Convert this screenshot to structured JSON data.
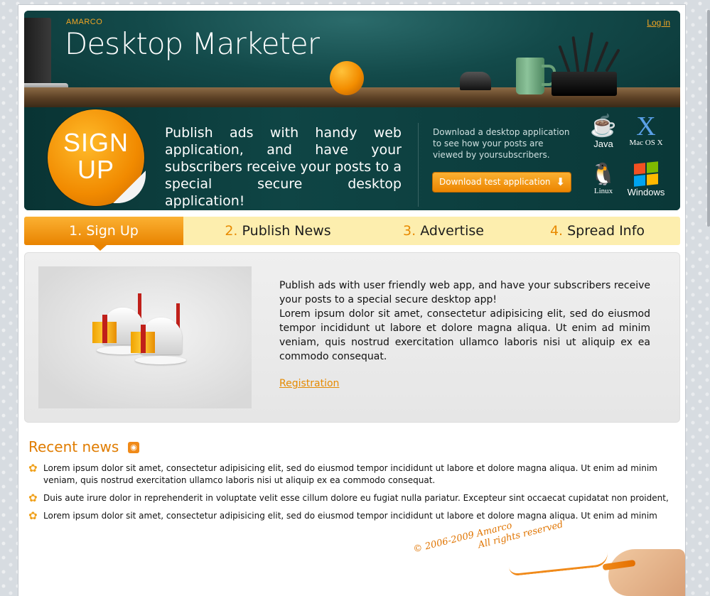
{
  "header": {
    "company": "AMARCO",
    "title": "Desktop Marketer",
    "login_label": "Log in",
    "signup_badge": "SIGN UP",
    "promo": "Publish ads with handy web application, and have your subscribers receive your posts to a special secure desktop application!",
    "download_text": "Download a desktop application to see how your posts are viewed by yoursubscribers.",
    "download_button": "Download test application",
    "platforms": [
      "Java",
      "Mac OS X",
      "Linux",
      "Windows"
    ]
  },
  "steps": [
    {
      "num": "1.",
      "label": "Sign Up",
      "active": true
    },
    {
      "num": "2.",
      "label": "Publish News",
      "active": false
    },
    {
      "num": "3.",
      "label": "Advertise",
      "active": false
    },
    {
      "num": "4.",
      "label": "Spread Info",
      "active": false
    }
  ],
  "content": {
    "intro": "Publish ads with user friendly web app, and have your subscribers receive your posts to a special secure desktop app!",
    "body": "Lorem ipsum dolor sit amet, consectetur adipisicing elit, sed do eiusmod tempor incididunt ut labore et dolore magna aliqua. Ut enim ad minim veniam, quis nostrud exercitation ullamco laboris nisi ut aliquip ex ea commodo consequat.",
    "registration_link": "Registration"
  },
  "news": {
    "title": "Recent news",
    "items": [
      "Lorem ipsum dolor sit amet, consectetur adipisicing elit, sed do eiusmod tempor incididunt ut labore et dolore magna aliqua. Ut enim ad minim veniam, quis nostrud exercitation ullamco laboris nisi ut aliquip ex ea commodo consequat.",
      "Duis aute irure dolor in reprehenderit in voluptate velit esse cillum dolore eu fugiat nulla pariatur. Excepteur sint occaecat cupidatat non proident,",
      "Lorem ipsum dolor sit amet, consectetur adipisicing elit, sed do eiusmod tempor incididunt ut labore et dolore magna aliqua. Ut enim ad minim"
    ]
  },
  "footer": {
    "copyright": "© 2006-2009 Amarco",
    "rights": "All rights reserved"
  },
  "colors": {
    "accent": "#f39200",
    "header_bg": "#0d3c3c",
    "step_bar": "#fdeeae"
  },
  "icons": [
    "java-icon",
    "macosx-icon",
    "linux-icon",
    "windows-icon",
    "rss-icon",
    "flower-bullet-icon",
    "arrow-down-icon"
  ]
}
